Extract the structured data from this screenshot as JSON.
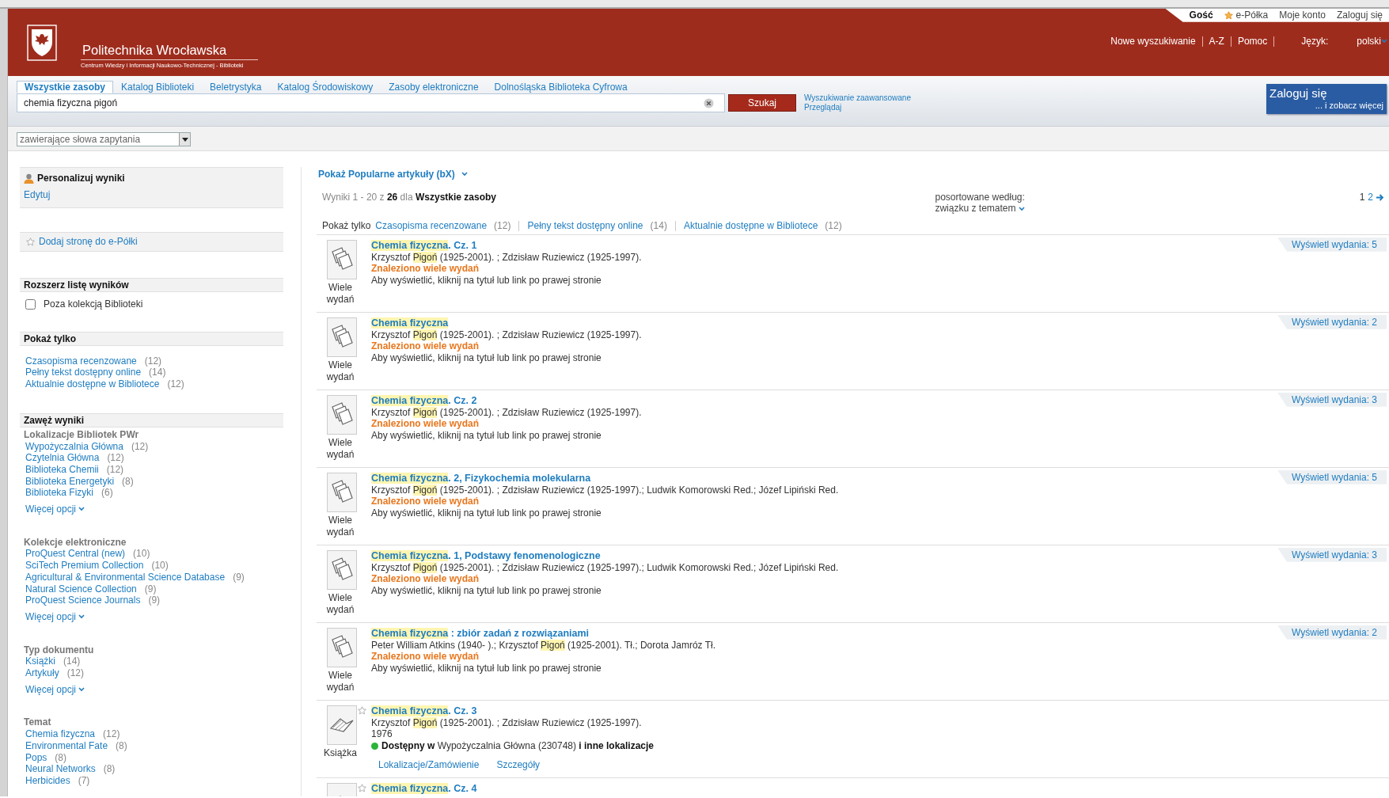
{
  "header": {
    "logo_title": "Politechnika Wrocławska",
    "logo_subtitle": "Centrum Wiedzy i Informacji Naukowo-Technicznej - Biblioteki",
    "user_label": "Gość",
    "shelf_link": "e-Półka",
    "user_links": [
      "Moje konto",
      "Zaloguj się"
    ],
    "nav_links": [
      "Nowe wyszukiwanie",
      "A-Z",
      "Pomoc"
    ],
    "language_label": "Język:",
    "language": "polski"
  },
  "search": {
    "tabs": [
      {
        "label": "Wszystkie zasoby",
        "selected": true
      },
      {
        "label": "Katalog Biblioteki",
        "selected": false
      },
      {
        "label": "Beletrystyka",
        "selected": false
      },
      {
        "label": "Katalog Środowiskowy",
        "selected": false
      },
      {
        "label": "Zasoby elektroniczne",
        "selected": false
      },
      {
        "label": "Dolnośląska Biblioteka Cyfrowa",
        "selected": false
      }
    ],
    "query": "chemia fizyczna pigoń",
    "button": "Szukaj",
    "links": [
      "Wyszukiwanie zaawansowane",
      "Przeglądaj"
    ],
    "scope": "zawierające słowa zapytania"
  },
  "login_box": {
    "title": "Zaloguj się",
    "subtitle": "... i zobacz więcej"
  },
  "sidebar": {
    "personalize": {
      "title": "Personalizuj wyniki",
      "link": "Edytuj"
    },
    "add_page": "Dodaj stronę do e-Półki",
    "expand": {
      "title": "Rozszerz listę wyników",
      "options": [
        {
          "label": "Poza kolekcją Biblioteki",
          "checked": false
        }
      ]
    },
    "show_only": {
      "title": "Pokaż tylko",
      "items": [
        {
          "label": "Czasopisma recenzowane",
          "count": "(12)"
        },
        {
          "label": "Pełny tekst dostępny online",
          "count": "(14)"
        },
        {
          "label": "Aktualnie dostępne w Bibliotece",
          "count": "(12)"
        }
      ]
    },
    "narrow": {
      "title": "Zawęż wyniki",
      "groups": [
        {
          "title": "Lokalizacje Bibliotek PWr",
          "items": [
            {
              "label": "Wypożyczalnia Główna",
              "count": "(12)"
            },
            {
              "label": "Czytelnia Główna",
              "count": "(12)"
            },
            {
              "label": "Biblioteka Chemii",
              "count": "(12)"
            },
            {
              "label": "Biblioteka Energetyki",
              "count": "(8)"
            },
            {
              "label": "Biblioteka Fizyki",
              "count": "(6)"
            }
          ],
          "more": "Więcej opcji"
        },
        {
          "title": "Kolekcje elektroniczne",
          "items": [
            {
              "label": "ProQuest Central (new)",
              "count": "(10)"
            },
            {
              "label": "SciTech Premium Collection",
              "count": "(10)"
            },
            {
              "label": "Agricultural & Environmental Science Database",
              "count": "(9)"
            },
            {
              "label": "Natural Science Collection",
              "count": "(9)"
            },
            {
              "label": "ProQuest Science Journals",
              "count": "(9)"
            }
          ],
          "more": "Więcej opcji"
        },
        {
          "title": "Typ dokumentu",
          "items": [
            {
              "label": "Książki",
              "count": "(14)"
            },
            {
              "label": "Artykuły",
              "count": "(12)"
            }
          ],
          "more": "Więcej opcji"
        },
        {
          "title": "Temat",
          "items": [
            {
              "label": "Chemia fizyczna",
              "count": "(12)"
            },
            {
              "label": "Environmental Fate",
              "count": "(8)"
            },
            {
              "label": "Pops",
              "count": "(8)"
            },
            {
              "label": "Neural Networks",
              "count": "(8)"
            },
            {
              "label": "Herbicides",
              "count": "(7)"
            }
          ]
        }
      ]
    }
  },
  "results": {
    "popular_link": "Pokaż Popularne artykuły (bX)",
    "summary": "Wyniki 1 - 20 z **26** dla **Wszystkie zasoby**",
    "sort_label": "posortowane według:",
    "sort_value": "związku z tematem",
    "pages": [
      {
        "label": "1",
        "selected": true
      },
      {
        "label": "2",
        "selected": false
      }
    ],
    "filter_label": "Pokaż tylko",
    "filters": [
      {
        "label": "Czasopisma recenzowane",
        "count": "(12)"
      },
      {
        "label": "Pełny tekst dostępny online",
        "count": "(14)"
      },
      {
        "label": "Aktualnie dostępne w Bibliotece",
        "count": "(12)"
      }
    ],
    "items": [
      {
        "kind": "multiple",
        "title": [
          {
            "text": "Chemia fizyczna",
            "highlighted": true
          },
          {
            "text": ". Cz. 1",
            "highlighted": false
          }
        ],
        "authors": [
          {
            "text": "Krzysztof ",
            "highlighted": false
          },
          {
            "text": "Pigoń",
            "highlighted": true
          },
          {
            "text": " (1925-2001). ; Zdzisław Ruziewicz (1925-1997).",
            "highlighted": false
          }
        ],
        "notice": "Znaleziono wiele wydań",
        "hint": "Aby wyświetlić, kliknij na tytuł lub link po prawej stronie",
        "type_label": "Wiele wydań",
        "editions_link": "Wyświetl wydania: 5"
      },
      {
        "kind": "multiple",
        "title": [
          {
            "text": "Chemia fizyczna",
            "highlighted": true
          }
        ],
        "authors": [
          {
            "text": "Krzysztof ",
            "highlighted": false
          },
          {
            "text": "Pigoń",
            "highlighted": true
          },
          {
            "text": " (1925-2001). ; Zdzisław Ruziewicz (1925-1997).",
            "highlighted": false
          }
        ],
        "notice": "Znaleziono wiele wydań",
        "hint": "Aby wyświetlić, kliknij na tytuł lub link po prawej stronie",
        "type_label": "Wiele wydań",
        "editions_link": "Wyświetl wydania: 2"
      },
      {
        "kind": "multiple",
        "title": [
          {
            "text": "Chemia fizyczna",
            "highlighted": true
          },
          {
            "text": ". Cz. 2",
            "highlighted": false
          }
        ],
        "authors": [
          {
            "text": "Krzysztof ",
            "highlighted": false
          },
          {
            "text": "Pigoń",
            "highlighted": true
          },
          {
            "text": " (1925-2001). ; Zdzisław Ruziewicz (1925-1997).",
            "highlighted": false
          }
        ],
        "notice": "Znaleziono wiele wydań",
        "hint": "Aby wyświetlić, kliknij na tytuł lub link po prawej stronie",
        "type_label": "Wiele wydań",
        "editions_link": "Wyświetl wydania: 3"
      },
      {
        "kind": "multiple",
        "title": [
          {
            "text": "Chemia fizyczna",
            "highlighted": true
          },
          {
            "text": ". 2, Fizykochemia molekularna",
            "highlighted": false
          }
        ],
        "authors": [
          {
            "text": "Krzysztof ",
            "highlighted": false
          },
          {
            "text": "Pigoń",
            "highlighted": true
          },
          {
            "text": " (1925-2001). ; Zdzisław Ruziewicz (1925-1997).; Ludwik Komorowski Red.; Józef Lipiński Red.",
            "highlighted": false
          }
        ],
        "notice": "Znaleziono wiele wydań",
        "hint": "Aby wyświetlić, kliknij na tytuł lub link po prawej stronie",
        "type_label": "Wiele wydań",
        "editions_link": "Wyświetl wydania: 5"
      },
      {
        "kind": "multiple",
        "title": [
          {
            "text": "Chemia fizyczna",
            "highlighted": true
          },
          {
            "text": ". 1, Podstawy fenomenologiczne",
            "highlighted": false
          }
        ],
        "authors": [
          {
            "text": "Krzysztof ",
            "highlighted": false
          },
          {
            "text": "Pigoń",
            "highlighted": true
          },
          {
            "text": " (1925-2001). ; Zdzisław Ruziewicz (1925-1997).; Ludwik Komorowski Red.; Józef Lipiński Red.",
            "highlighted": false
          }
        ],
        "notice": "Znaleziono wiele wydań",
        "hint": "Aby wyświetlić, kliknij na tytuł lub link po prawej stronie",
        "type_label": "Wiele wydań",
        "editions_link": "Wyświetl wydania: 3"
      },
      {
        "kind": "multiple",
        "title": [
          {
            "text": "Chemia fizyczna",
            "highlighted": true
          },
          {
            "text": " : zbiór zadań z rozwiązaniami",
            "highlighted": false
          }
        ],
        "authors": [
          {
            "text": "Peter William Atkins (1940- ).; Krzysztof ",
            "highlighted": false
          },
          {
            "text": "Pigoń",
            "highlighted": true
          },
          {
            "text": " (1925-2001). Tł.; Dorota Jamróz Tł.",
            "highlighted": false
          }
        ],
        "notice": "Znaleziono wiele wydań",
        "hint": "Aby wyświetlić, kliknij na tytuł lub link po prawej stronie",
        "type_label": "Wiele wydań",
        "editions_link": "Wyświetl wydania: 2"
      },
      {
        "kind": "book",
        "title": [
          {
            "text": "Chemia fizyczna",
            "highlighted": true
          },
          {
            "text": ". Cz. 3",
            "highlighted": false
          }
        ],
        "authors": [
          {
            "text": "Krzysztof ",
            "highlighted": false
          },
          {
            "text": "Pigoń",
            "highlighted": true
          },
          {
            "text": " (1925-2001). ; Zdzisław Ruziewicz (1925-1997).",
            "highlighted": false
          }
        ],
        "year": "1976",
        "available": true,
        "availability": "**Dostępny w** Wypożyczalnia Główna  (230748) **i inne lokalizacje**",
        "type_label": "Książka",
        "links": [
          "Lokalizacje/Zamówienie",
          "Szczegóły"
        ]
      },
      {
        "kind": "book",
        "title": [
          {
            "text": "Chemia fizyczna",
            "highlighted": true
          },
          {
            "text": ". Cz. 4",
            "highlighted": false
          }
        ]
      }
    ]
  }
}
